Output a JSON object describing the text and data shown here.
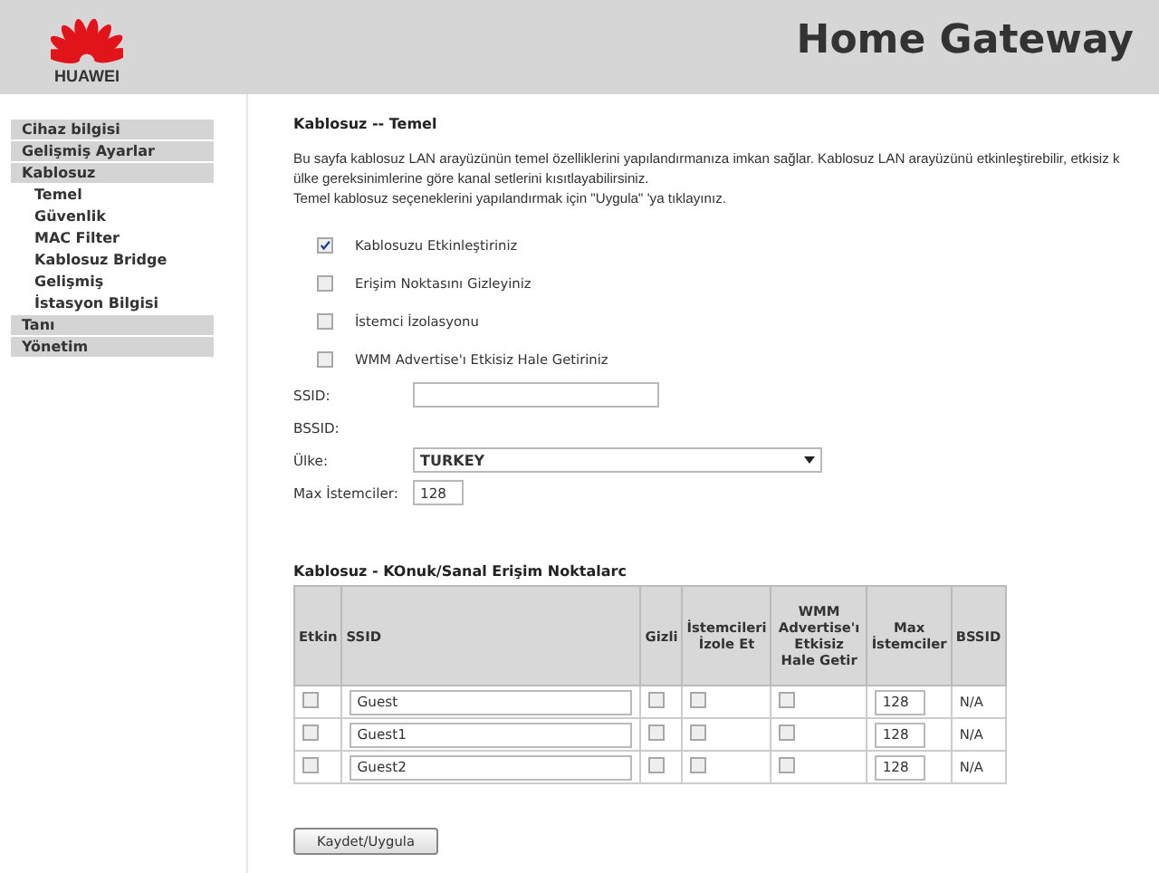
{
  "header": {
    "brand": "HUAWEI",
    "title": "Home Gateway"
  },
  "sidebar": {
    "items": [
      {
        "label": "Cihaz bilgisi"
      },
      {
        "label": "Gelişmiş Ayarlar"
      },
      {
        "label": "Kablosuz",
        "children": [
          {
            "label": "Temel"
          },
          {
            "label": "Güvenlik"
          },
          {
            "label": "MAC Filter"
          },
          {
            "label": "Kablosuz Bridge"
          },
          {
            "label": "Gelişmiş"
          },
          {
            "label": "İstasyon Bilgisi"
          }
        ]
      },
      {
        "label": "Tanı"
      },
      {
        "label": "Yönetim"
      }
    ]
  },
  "content": {
    "title": "Kablosuz -- Temel",
    "description": [
      "Bu sayfa kablosuz LAN arayüzünün temel özelliklerini yapılandırmanıza imkan sağlar. Kablosuz LAN arayüzünü etkinleştirebilir, etkisiz k",
      "ülke gereksinimlerine göre kanal setlerini kısıtlayabilirsiniz.",
      "Temel kablosuz seçeneklerini yapılandırmak için \"Uygula\" 'ya tıklayınız."
    ],
    "options": [
      {
        "label": "Kablosuzu Etkinleştiriniz",
        "checked": true
      },
      {
        "label": "Erişim Noktasını Gizleyiniz",
        "checked": false
      },
      {
        "label": "İstemci İzolasyonu",
        "checked": false
      },
      {
        "label": "WMM Advertise'ı Etkisiz Hale Getiriniz",
        "checked": false
      }
    ],
    "fields": [
      {
        "kind": "text",
        "label": "SSID:"
      },
      {
        "kind": "static",
        "label": "BSSID:"
      },
      {
        "kind": "select",
        "label": "Ülke:",
        "value": "TURKEY"
      },
      {
        "kind": "short",
        "label": "Max İstemciler:",
        "value": "128"
      }
    ]
  },
  "table": {
    "title": "Kablosuz - KOnuk/Sanal Erişim Noktalarc",
    "columns": [
      "Etkin",
      "SSID",
      "Gizli",
      "İstemcileri İzole Et",
      "WMM Advertise'ı Etkisiz Hale Getir",
      "Max İstemciler",
      "BSSID"
    ],
    "rows": [
      {
        "enabled": false,
        "ssid": "Guest",
        "hidden": false,
        "isolate": false,
        "wmm_disabled": false,
        "max_clients": "128",
        "bssid": "N/A"
      },
      {
        "enabled": false,
        "ssid": "Guest1",
        "hidden": false,
        "isolate": false,
        "wmm_disabled": false,
        "max_clients": "128",
        "bssid": "N/A"
      },
      {
        "enabled": false,
        "ssid": "Guest2",
        "hidden": false,
        "isolate": false,
        "wmm_disabled": false,
        "max_clients": "128",
        "bssid": "N/A"
      }
    ]
  },
  "buttons": [
    "Kaydet/Uygula"
  ]
}
